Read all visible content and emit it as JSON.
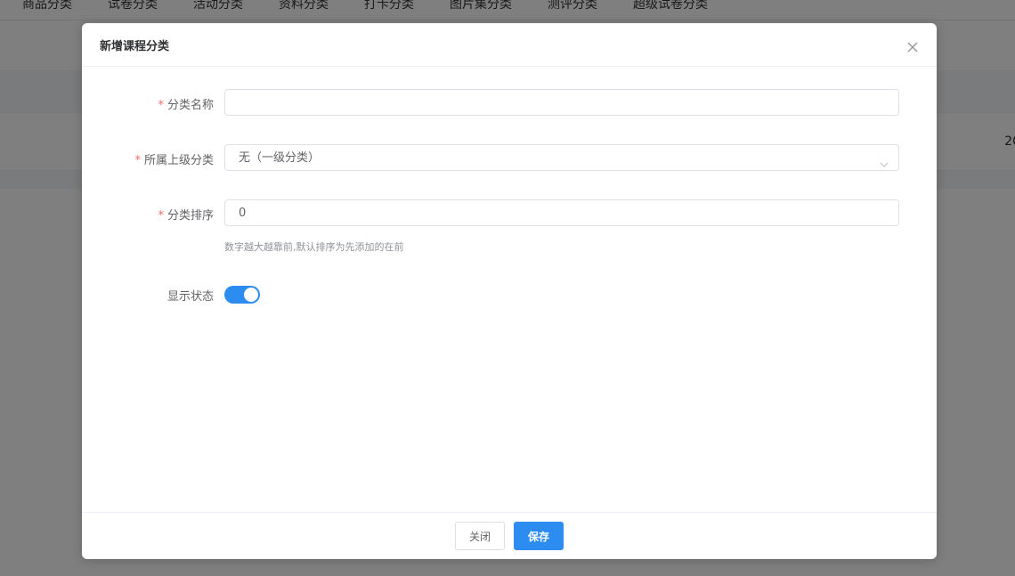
{
  "background": {
    "tabs": [
      "商品分类",
      "试卷分类",
      "活动分类",
      "资料分类",
      "打卡分类",
      "图片集分类",
      "测评分类",
      "超级试卷分类"
    ],
    "table_cell_partial": "20"
  },
  "dialog": {
    "title": "新增课程分类",
    "close_icon": "close-icon",
    "fields": {
      "name": {
        "label": "分类名称",
        "required_mark": "*",
        "value": "",
        "placeholder": ""
      },
      "parent": {
        "label": "所属上级分类",
        "required_mark": "*",
        "selected": "无（一级分类）",
        "arrow_icon": "chevron-down-icon"
      },
      "order": {
        "label": "分类排序",
        "required_mark": "*",
        "value": "0",
        "hint": "数字越大越靠前,默认排序为先添加的在前"
      },
      "status": {
        "label": "显示状态",
        "on": true
      }
    },
    "footer": {
      "close_label": "关闭",
      "save_label": "保存"
    }
  },
  "colors": {
    "primary": "#2d8cf0",
    "required": "#f56c6c",
    "overlay": "rgba(0,0,0,0.5)"
  }
}
